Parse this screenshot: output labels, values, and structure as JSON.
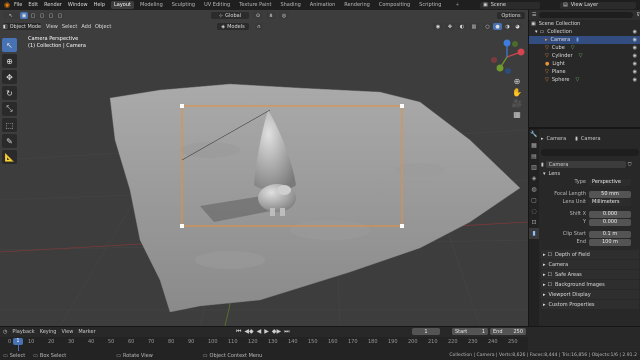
{
  "topbar": {
    "menus": [
      "File",
      "Edit",
      "Render",
      "Window",
      "Help"
    ],
    "workspaces": [
      "Layout",
      "Modeling",
      "Sculpting",
      "UV Editing",
      "Texture Paint",
      "Shading",
      "Animation",
      "Rendering",
      "Compositing",
      "Scripting"
    ],
    "active_workspace": "Layout",
    "scene_label": "Scene",
    "view_layer_label": "View Layer"
  },
  "header": {
    "mode": "Object Mode",
    "view": "View",
    "select": "Select",
    "add": "Add",
    "object": "Object",
    "transform_orientation": "Global",
    "snap_target": "Models",
    "options": "Options"
  },
  "viewport": {
    "camera_perspective": "Camera Perspective",
    "collection_line": "(1) Collection | Camera"
  },
  "outliner": {
    "scene_collection": "Scene Collection",
    "collection": "Collection",
    "items": [
      "Camera",
      "Cube",
      "Cylinder",
      "Light",
      "Plane",
      "Sphere"
    ]
  },
  "properties": {
    "object_name": "Camera",
    "data_name": "Camera",
    "data_field": "Camera",
    "lens_header": "Lens",
    "type_label": "Type",
    "type_value": "Perspective",
    "focal_label": "Focal Length",
    "focal_value": "50 mm",
    "lens_unit_label": "Lens Unit",
    "lens_unit_value": "Millimeters",
    "shift_x_label": "Shift X",
    "shift_x_value": "0.000",
    "shift_y_label": "Y",
    "shift_y_value": "0.000",
    "clip_start_label": "Clip Start",
    "clip_start_value": "0.1 m",
    "clip_end_label": "End",
    "clip_end_value": "100 m",
    "sections": [
      "Depth of Field",
      "Camera",
      "Safe Areas",
      "Background Images",
      "Viewport Display",
      "Custom Properties"
    ]
  },
  "timeline": {
    "playback": "Playback",
    "keying": "Keying",
    "view": "View",
    "marker": "Marker",
    "current_frame": "1",
    "start_label": "Start",
    "start_value": "1",
    "end_label": "End",
    "end_value": "250",
    "ruler": [
      "0",
      "10",
      "20",
      "30",
      "40",
      "50",
      "60",
      "70",
      "80",
      "90",
      "100",
      "110",
      "120",
      "130",
      "140",
      "150",
      "160",
      "170",
      "180",
      "190",
      "200",
      "210",
      "220",
      "230",
      "240",
      "250"
    ]
  },
  "status": {
    "select": "Select",
    "box_select": "Box Select",
    "rotate_view": "Rotate View",
    "context_menu": "Object Context Menu",
    "stats": "Collection | Camera | Verts:8,626 | Faces:8,444 | Tris:16,856 | Objects:1/6 | 2.91.2"
  },
  "colors": {
    "accent": "#4772b3",
    "selection": "#334d80",
    "camera_frame": "#e8903a",
    "brand": "#e87d0d"
  }
}
